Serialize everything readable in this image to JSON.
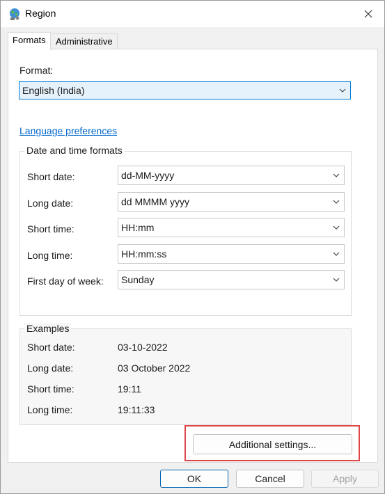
{
  "window": {
    "title": "Region"
  },
  "tabs": [
    {
      "label": "Formats"
    },
    {
      "label": "Administrative"
    }
  ],
  "format": {
    "label": "Format:",
    "value": "English (India)"
  },
  "language_link": "Language preferences",
  "date_time": {
    "title": "Date and time formats",
    "rows": [
      {
        "label": "Short date:",
        "value": "dd-MM-yyyy"
      },
      {
        "label": "Long date:",
        "value": "dd MMMM yyyy"
      },
      {
        "label": "Short time:",
        "value": "HH:mm"
      },
      {
        "label": "Long time:",
        "value": "HH:mm:ss"
      },
      {
        "label": "First day of week:",
        "value": "Sunday"
      }
    ]
  },
  "examples": {
    "title": "Examples",
    "rows": [
      {
        "label": "Short date:",
        "value": "03-10-2022"
      },
      {
        "label": "Long date:",
        "value": "03 October 2022"
      },
      {
        "label": "Short time:",
        "value": "19:11"
      },
      {
        "label": "Long time:",
        "value": "19:11:33"
      }
    ]
  },
  "buttons": {
    "additional": "Additional settings...",
    "ok": "OK",
    "cancel": "Cancel",
    "apply": "Apply"
  },
  "colors": {
    "highlight": "#e0454a",
    "link": "#0066cc",
    "focus": "#0078d7"
  }
}
